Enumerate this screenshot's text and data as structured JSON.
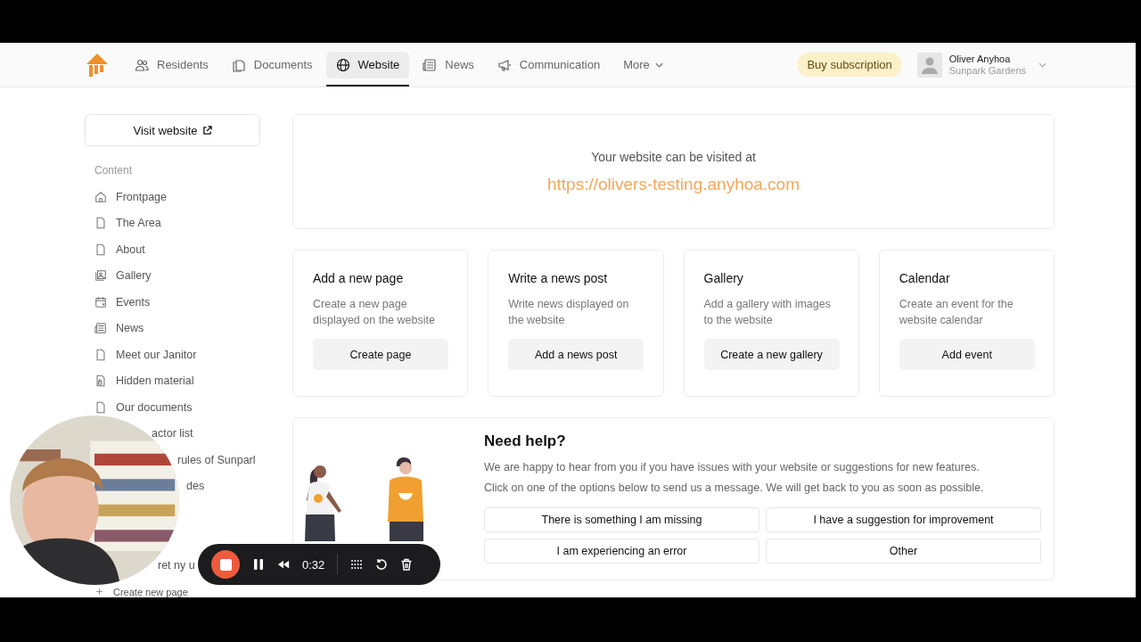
{
  "nav": {
    "tabs": [
      {
        "label": "Residents",
        "kind": "people",
        "selected": false
      },
      {
        "label": "Documents",
        "kind": "docs",
        "selected": false
      },
      {
        "label": "Website",
        "kind": "globe",
        "selected": true
      },
      {
        "label": "News",
        "kind": "news",
        "selected": false
      },
      {
        "label": "Communication",
        "kind": "megaphone",
        "selected": false
      }
    ],
    "more": "More",
    "subscribe": "Buy subscription",
    "user": {
      "name": "Oliver Anyhoa",
      "community": "Sunpark Gardens"
    }
  },
  "sidebar": {
    "visit": "Visit website",
    "heading": "Content",
    "items": [
      {
        "label": "Frontpage",
        "kind": "home"
      },
      {
        "label": "The Area",
        "kind": "page"
      },
      {
        "label": "About",
        "kind": "page"
      },
      {
        "label": "Gallery",
        "kind": "gallery"
      },
      {
        "label": "Events",
        "kind": "events"
      },
      {
        "label": "News",
        "kind": "news"
      },
      {
        "label": "Meet our Janitor",
        "kind": "page"
      },
      {
        "label": "Hidden material",
        "kind": "locked"
      },
      {
        "label": "Our documents",
        "kind": "page"
      },
      {
        "label": "actor list",
        "kind": "covered"
      },
      {
        "label": "rules of Sunparl",
        "kind": "covered"
      },
      {
        "label": "des",
        "kind": "covered"
      },
      {
        "label": "ret ny u",
        "kind": "covered"
      }
    ],
    "create": "Create new page"
  },
  "visit_card": {
    "text": "Your website can be visited at",
    "url": "https://olivers-testing.anyhoa.com"
  },
  "actions": [
    {
      "title": "Add a new page",
      "text": "Create a new page displayed on the website",
      "button": "Create page"
    },
    {
      "title": "Write a news post",
      "text": "Write news displayed on the website",
      "button": "Add a news post"
    },
    {
      "title": "Gallery",
      "text": "Add a gallery with images to the website",
      "button": "Create a new gallery"
    },
    {
      "title": "Calendar",
      "text": "Create an event for the website calendar",
      "button": "Add event"
    }
  ],
  "help": {
    "title": "Need help?",
    "lines": [
      "We are happy to hear from you if you have issues with your website or suggestions for new features.",
      "Click on one of the options below to send us a message. We will get back to you as soon as possible."
    ],
    "options": [
      "There is something I am missing",
      "I have a suggestion for improvement",
      "I am experiencing an error",
      "Other"
    ]
  },
  "recorder": {
    "time": "0:32"
  }
}
